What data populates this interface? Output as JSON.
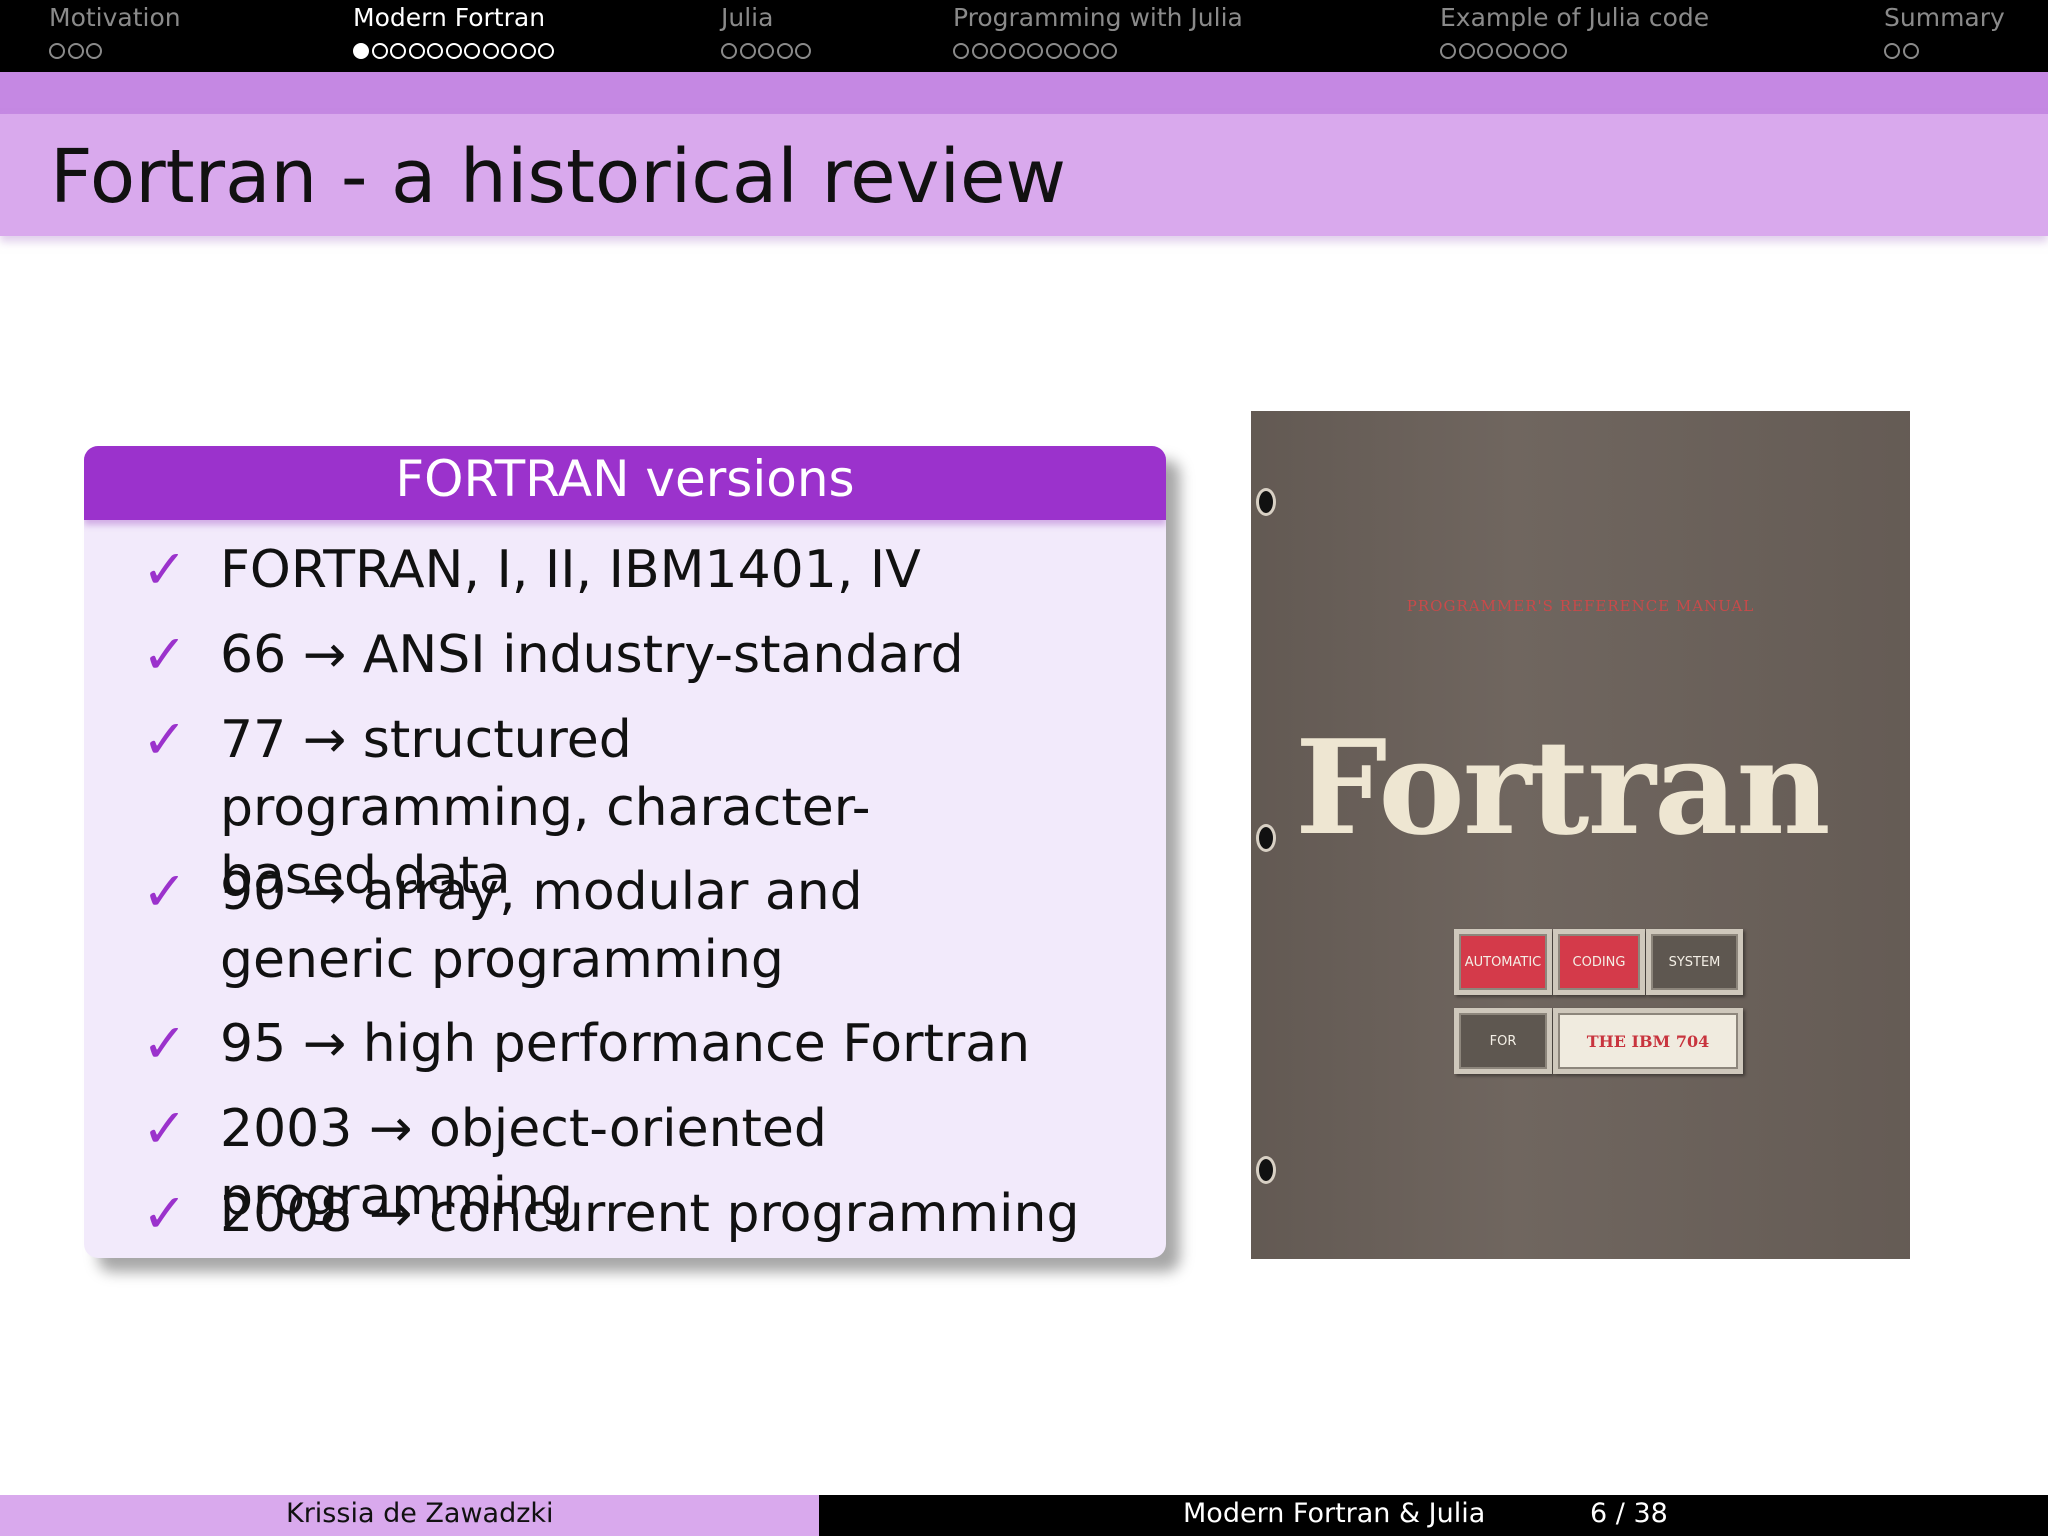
{
  "nav": {
    "sections": [
      {
        "label": "Motivation",
        "dots": 3,
        "current": -1,
        "active": false
      },
      {
        "label": "Modern Fortran",
        "dots": 11,
        "current": 0,
        "active": true
      },
      {
        "label": "Julia",
        "dots": 5,
        "current": -1,
        "active": false
      },
      {
        "label": "Programming with Julia",
        "dots": 9,
        "current": -1,
        "active": false
      },
      {
        "label": "Example of Julia code",
        "dots": 7,
        "current": -1,
        "active": false
      },
      {
        "label": "Summary",
        "dots": 2,
        "current": -1,
        "active": false
      }
    ]
  },
  "slide": {
    "title": "Fortran - a historical review"
  },
  "block": {
    "title": "FORTRAN versions",
    "check_symbol": "✓",
    "items": [
      "FORTRAN, I, II, IBM1401, IV",
      "66 → ANSI industry-standard",
      "77 → structured programming, character-based data",
      "90 → array, modular and generic programming",
      "95 → high performance Fortran",
      "2003 → object-oriented programming",
      "2008 → concurrent programming"
    ]
  },
  "cover": {
    "subtitle": "PROGRAMMER'S REFERENCE MANUAL",
    "title": "Fortran",
    "plates": [
      "AUTOMATIC",
      "CODING",
      "SYSTEM",
      "FOR",
      "THE IBM 704"
    ]
  },
  "footer": {
    "author": "Krissia de Zawadzki",
    "talk": "Modern Fortran & Julia",
    "page": "6 / 38"
  },
  "colors": {
    "accent": "#9b32cc",
    "band": "#d9a9ed",
    "block_body": "#f2eafb"
  }
}
